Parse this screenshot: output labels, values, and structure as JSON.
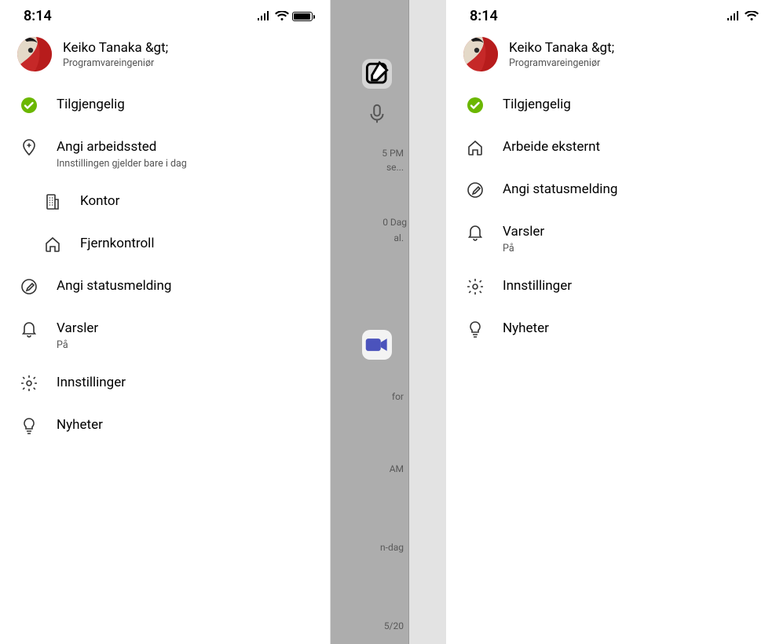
{
  "status_time": "8:14",
  "profile": {
    "name": "Keiko Tanaka &gt;",
    "role": "Programvareingeniør"
  },
  "left": {
    "available": "Tilgjengelig",
    "set_location": {
      "label": "Angi arbeidssted",
      "sub": "Innstillingen gjelder bare i dag"
    },
    "office": "Kontor",
    "remote": "Fjernkontroll",
    "status_msg": "Angi statusmelding",
    "notifications": {
      "label": "Varsler",
      "sub": "På"
    },
    "settings": "Innstillinger",
    "whatsnew": "Nyheter"
  },
  "right": {
    "available": "Tilgjengelig",
    "work_remote": "Arbeide eksternt",
    "status_msg": "Angi statusmelding",
    "notifications": {
      "label": "Varsler",
      "sub": "På"
    },
    "settings": "Innstillinger",
    "whatsnew": "Nyheter"
  },
  "bg": {
    "time1": "5 PM",
    "line1": "se...",
    "day1": "0",
    "day1b": "Dag",
    "line2": "al.",
    "line3": "for",
    "time2": "AM",
    "line4": "n-dag",
    "line5": "5/20"
  }
}
